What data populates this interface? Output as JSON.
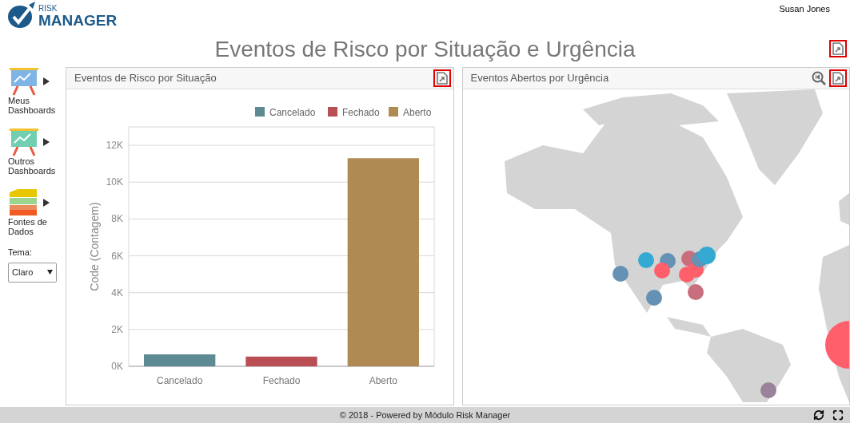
{
  "header": {
    "logo_small": "RISK",
    "logo_large": "MANAGER",
    "user": "Susan Jones"
  },
  "page_title": "Eventos de Risco por Situação e Urgência",
  "sidebar": {
    "items": [
      {
        "label": "Meus Dashboards",
        "kind": "board",
        "color": "#7fb4e6"
      },
      {
        "label": "Outros Dashboards",
        "kind": "board",
        "color": "#6fcfb0"
      },
      {
        "label": "Fontes de Dados",
        "kind": "layers"
      }
    ],
    "theme": {
      "label": "Tema:",
      "value": "Claro"
    }
  },
  "panels": [
    {
      "title": "Eventos de Risco por Situação",
      "kind": "chart",
      "chart_data": {
        "type": "bar",
        "grid": true,
        "legend": true,
        "ylabel": "Code (Contagem)",
        "categories": [
          "Cancelado",
          "Fechado",
          "Aberto"
        ],
        "ylim": [
          0,
          13000
        ],
        "yticks": [
          {
            "value": 0,
            "label": "0K"
          },
          {
            "value": 2000,
            "label": "2K"
          },
          {
            "value": 4000,
            "label": "4K"
          },
          {
            "value": 6000,
            "label": "6K"
          },
          {
            "value": 8000,
            "label": "8K"
          },
          {
            "value": 10000,
            "label": "10K"
          },
          {
            "value": 12000,
            "label": "12K"
          }
        ],
        "series": [
          {
            "name": "Cancelado",
            "color": "#5e8a93",
            "values": [
              650,
              null,
              null
            ]
          },
          {
            "name": "Fechado",
            "color": "#b94e55",
            "values": [
              null,
              530,
              null
            ]
          },
          {
            "name": "Aberto",
            "color": "#af8a52",
            "values": [
              null,
              null,
              11300
            ]
          }
        ]
      }
    },
    {
      "title": "Eventos Abertos por Urgência",
      "kind": "map"
    }
  ],
  "footer": {
    "text": "© 2018 - Powered by Módulo Risk Manager"
  }
}
